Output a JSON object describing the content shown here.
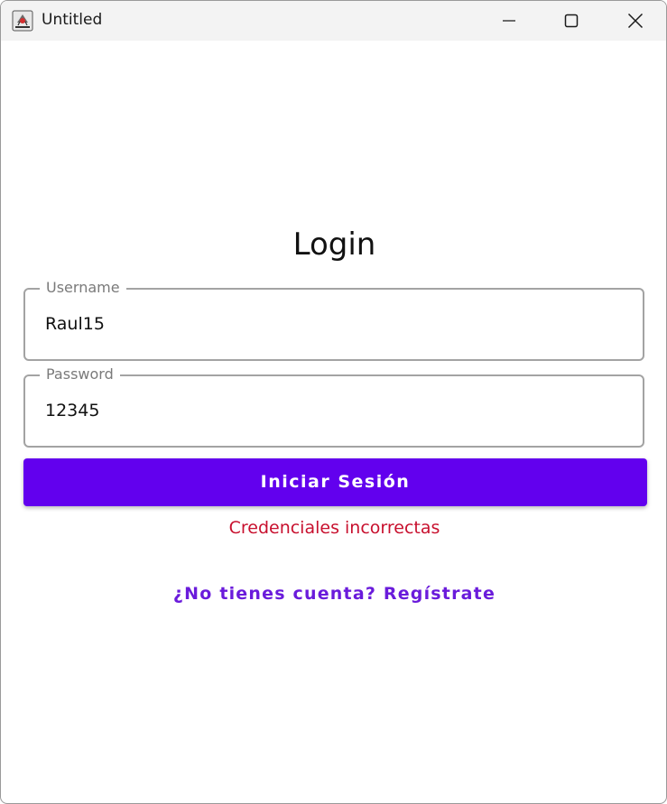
{
  "window": {
    "title": "Untitled",
    "app_icon": "java-app-icon",
    "controls": {
      "minimize_icon": "minimize-icon",
      "maximize_icon": "maximize-icon",
      "close_icon": "close-icon"
    }
  },
  "form": {
    "title": "Login",
    "username": {
      "label": "Username",
      "value": "Raul15"
    },
    "password": {
      "label": "Password",
      "value": "12345"
    },
    "submit_label": "Iniciar Sesión",
    "error_message": "Credenciales incorrectas",
    "register_link": "¿No tienes cuenta? Regístrate"
  },
  "colors": {
    "primary": "#6200ee",
    "error": "#c8102e",
    "link": "#6a1bdb",
    "field_border": "#a3a3a3",
    "titlebar": "#f3f3f3"
  }
}
